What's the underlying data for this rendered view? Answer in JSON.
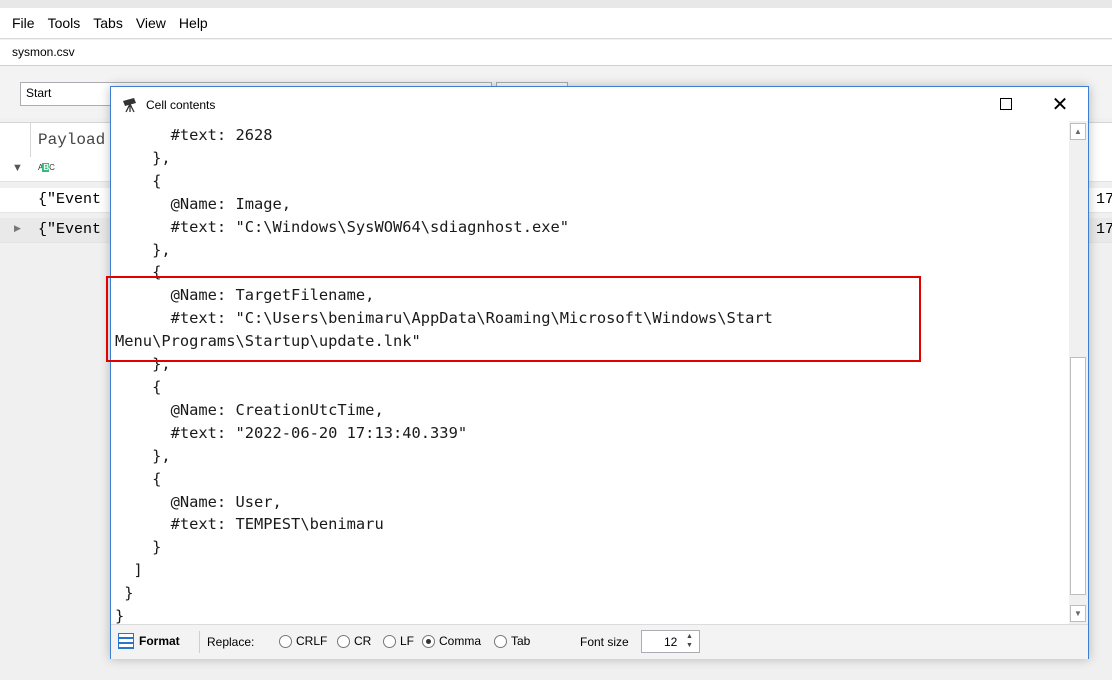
{
  "menu": [
    "File",
    "Tools",
    "Tabs",
    "View",
    "Help"
  ],
  "file_tab": "sysmon.csv",
  "toolbar": {
    "combo_value": "Start"
  },
  "grid": {
    "column_header": "Payload",
    "rows": [
      {
        "text": "{\"Event",
        "right": "17"
      },
      {
        "text": "{\"Event",
        "right": "17"
      }
    ]
  },
  "dialog": {
    "title": "Cell contents",
    "close_glyph": "✕",
    "content": "      #text: 2628\n    },\n    {\n      @Name: Image,\n      #text: \"C:\\Windows\\SysWOW64\\sdiagnhost.exe\"\n    },\n    {\n      @Name: TargetFilename,\n      #text: \"C:\\Users\\benimaru\\AppData\\Roaming\\Microsoft\\Windows\\Start\nMenu\\Programs\\Startup\\update.lnk\"\n    },\n    {\n      @Name: CreationUtcTime,\n      #text: \"2022-06-20 17:13:40.339\"\n    },\n    {\n      @Name: User,\n      #text: TEMPEST\\benimaru\n    }\n  ]\n }\n}",
    "footer": {
      "format_label": "Format",
      "replace_label": "Replace:",
      "options": [
        {
          "label": "CRLF",
          "checked": false
        },
        {
          "label": "CR",
          "checked": false
        },
        {
          "label": "LF",
          "checked": false
        },
        {
          "label": "Comma",
          "checked": true
        },
        {
          "label": "Tab",
          "checked": false
        }
      ],
      "font_size_label": "Font size",
      "font_size_value": "12"
    }
  }
}
